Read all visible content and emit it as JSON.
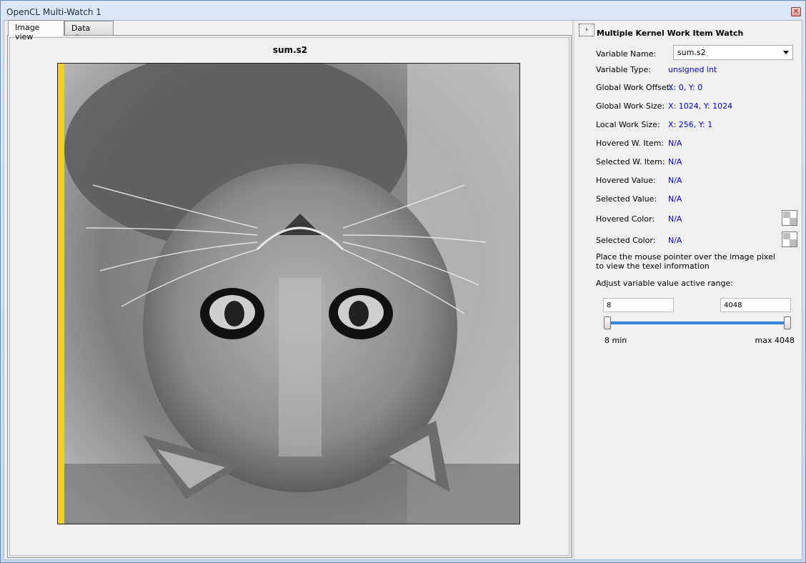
{
  "window": {
    "title": "OpenCL Multi-Watch 1",
    "close_label": "✕"
  },
  "tabs": [
    {
      "label": "Image view",
      "active": true
    },
    {
      "label": "Data view",
      "active": false
    }
  ],
  "image_view": {
    "title": "sum.s2",
    "strip_color": "#f2cf2e"
  },
  "panel": {
    "collapse_label": "›",
    "title": "Multiple Kernel Work Item Watch",
    "variable_name": {
      "label": "Variable Name:",
      "value": "sum.s2"
    },
    "variable_type": {
      "label": "Variable Type:",
      "value": "unsigned int"
    },
    "global_offset": {
      "label": "Global Work Offset:",
      "value": "X: 0, Y: 0"
    },
    "global_size": {
      "label": "Global Work Size:",
      "value": "X: 1024, Y: 1024"
    },
    "local_size": {
      "label": "Local Work Size:",
      "value": "X: 256, Y: 1"
    },
    "hovered_item": {
      "label": "Hovered W. Item:",
      "value": "N/A"
    },
    "selected_item": {
      "label": "Selected W. Item:",
      "value": "N/A"
    },
    "hovered_value": {
      "label": "Hovered Value:",
      "value": "N/A"
    },
    "selected_value": {
      "label": "Selected Value:",
      "value": "N/A"
    },
    "hovered_color": {
      "label": "Hovered Color:",
      "value": "N/A"
    },
    "selected_color": {
      "label": "Selected Color:",
      "value": "N/A"
    },
    "info_line1": "Place the mouse pointer over the image pixel",
    "info_line2": "to view the texel information",
    "adjust_label": "Adjust variable value active range:",
    "range": {
      "min_value": "8",
      "max_value": "4048",
      "min_label": "8 min",
      "max_label": "max 4048"
    },
    "value_color": "#0000cc"
  }
}
